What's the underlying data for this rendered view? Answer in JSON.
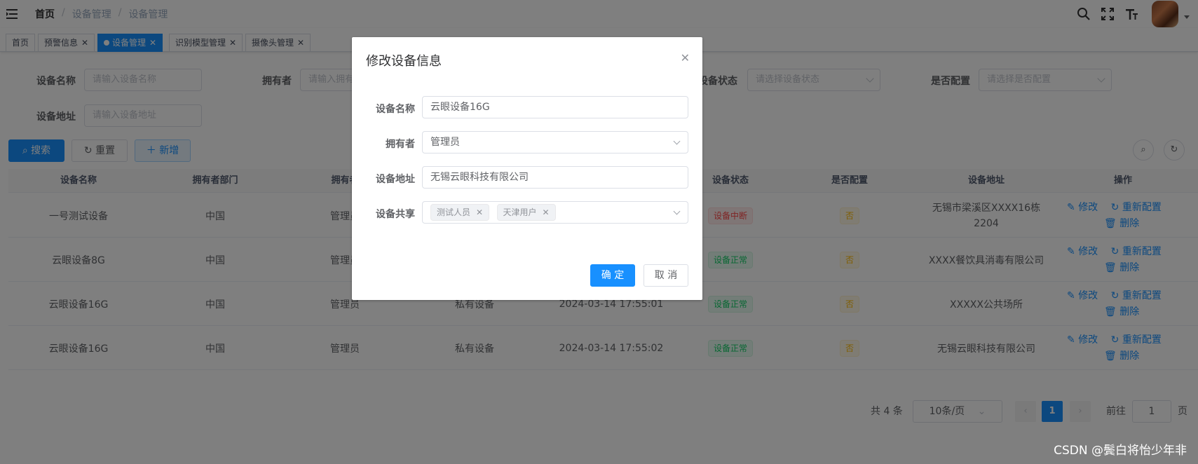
{
  "header": {
    "breadcrumb": [
      "首页",
      "设备管理",
      "设备管理"
    ],
    "separator": "/"
  },
  "tags": [
    {
      "label": "首页",
      "closable": false,
      "active": false
    },
    {
      "label": "预警信息",
      "closable": true,
      "active": false
    },
    {
      "label": "设备管理",
      "closable": true,
      "active": true
    },
    {
      "label": "识别模型管理",
      "closable": true,
      "active": false
    },
    {
      "label": "摄像头管理",
      "closable": true,
      "active": false
    }
  ],
  "search": {
    "name_label": "设备名称",
    "name_placeholder": "请输入设备名称",
    "owner_label": "拥有者",
    "owner_placeholder": "请输入拥有",
    "status_label": "设备状态",
    "status_placeholder": "请选择设备状态",
    "config_label": "是否配置",
    "config_placeholder": "请选择是否配置",
    "address_label": "设备地址",
    "address_placeholder": "请输入设备地址",
    "search_btn": "搜索",
    "reset_btn": "重置",
    "add_btn": "新增"
  },
  "table": {
    "headers": [
      "设备名称",
      "拥有者部门",
      "拥有者",
      "设备状态",
      "是否配置",
      "设备地址",
      "操作"
    ],
    "rows": [
      {
        "name": "一号测试设备",
        "dept": "中国",
        "owner": "管理员",
        "type": "",
        "time": "",
        "status": "设备中断",
        "status_kind": "danger",
        "config": "否",
        "address": "无锡市梁溪区XXXX16栋2204"
      },
      {
        "name": "云眼设备8G",
        "dept": "中国",
        "owner": "管理员",
        "type": "",
        "time": "",
        "status": "设备正常",
        "status_kind": "success",
        "config": "否",
        "address": "XXXX餐饮具消毒有限公司"
      },
      {
        "name": "云眼设备16G",
        "dept": "中国",
        "owner": "管理员",
        "type": "私有设备",
        "time": "2024-03-14 17:55:01",
        "status": "设备正常",
        "status_kind": "success",
        "config": "否",
        "address": "XXXXX公共场所"
      },
      {
        "name": "云眼设备16G",
        "dept": "中国",
        "owner": "管理员",
        "type": "私有设备",
        "time": "2024-03-14 17:55:02",
        "status": "设备正常",
        "status_kind": "success",
        "config": "否",
        "address": "无锡云眼科技有限公司"
      }
    ],
    "edit_label": "修改",
    "reconfig_label": "重新配置",
    "delete_label": "删除"
  },
  "pagination": {
    "total_text": "共 4 条",
    "page_size": "10条/页",
    "current_page": "1",
    "goto_label": "前往",
    "goto_value": "1",
    "page_suffix": "页"
  },
  "dialog": {
    "title": "修改设备信息",
    "name_label": "设备名称",
    "name_value": "云眼设备16G",
    "owner_label": "拥有者",
    "owner_value": "管理员",
    "address_label": "设备地址",
    "address_value": "无锡云眼科技有限公司",
    "share_label": "设备共享",
    "share_chips": [
      "测试人员",
      "天津用户"
    ],
    "confirm_btn": "确 定",
    "cancel_btn": "取 消"
  },
  "watermark": "CSDN @鬓白将怡少年非",
  "colors": {
    "primary": "#1890ff",
    "danger": "#ff4949",
    "success": "#13ce66",
    "warning": "#ffba00"
  }
}
